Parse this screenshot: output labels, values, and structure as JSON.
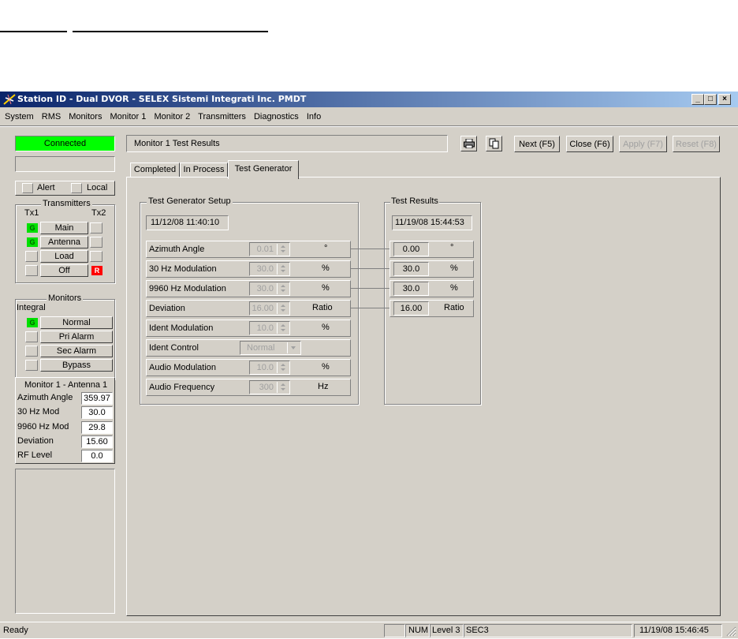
{
  "window": {
    "title": "Station ID - Dual DVOR - SELEX Sistemi Integrati Inc. PMDT"
  },
  "menu": [
    "System",
    "RMS",
    "Monitors",
    "Monitor 1",
    "Monitor 2",
    "Transmitters",
    "Diagnostics",
    "Info"
  ],
  "left_panel": {
    "connection_status": "Connected",
    "alert_label": "Alert",
    "local_label": "Local",
    "transmitters": {
      "title": "Transmitters",
      "tx1": "Tx1",
      "tx2": "Tx2",
      "rows": [
        {
          "label": "Main",
          "left": "G",
          "right": ""
        },
        {
          "label": "Antenna",
          "left": "G",
          "right": ""
        },
        {
          "label": "Load",
          "left": "",
          "right": ""
        },
        {
          "label": "Off",
          "left": "",
          "right": "R"
        }
      ]
    },
    "monitors": {
      "title": "Monitors",
      "subtitle": "Integral",
      "rows": [
        {
          "label": "Normal",
          "led": "G"
        },
        {
          "label": "Pri Alarm",
          "led": ""
        },
        {
          "label": "Sec Alarm",
          "led": ""
        },
        {
          "label": "Bypass",
          "led": ""
        }
      ],
      "readout_title": "Monitor 1 - Antenna 1",
      "readouts": [
        {
          "label": "Azimuth Angle",
          "value": "359.97"
        },
        {
          "label": "30 Hz Mod",
          "value": "30.0"
        },
        {
          "label": "9960 Hz Mod",
          "value": "29.8"
        },
        {
          "label": "Deviation",
          "value": "15.60"
        },
        {
          "label": "RF Level",
          "value": "0.0"
        }
      ]
    }
  },
  "header": {
    "title": "Monitor 1 Test Results",
    "print_icon": "printer-icon",
    "copy_icon": "copy-icon",
    "buttons": {
      "next": "Next (F5)",
      "close": "Close (F6)",
      "apply": "Apply (F7)",
      "reset": "Reset (F8)"
    }
  },
  "tabs": [
    "Completed",
    "In Process",
    "Test Generator"
  ],
  "test_generator_setup": {
    "title": "Test Generator Setup",
    "timestamp": "11/12/08 11:40:10",
    "rows": [
      {
        "label": "Azimuth Angle",
        "value": "0.01",
        "unit": "°"
      },
      {
        "label": "30 Hz Modulation",
        "value": "30.0",
        "unit": "%"
      },
      {
        "label": "9960 Hz Modulation",
        "value": "30.0",
        "unit": "%"
      },
      {
        "label": "Deviation",
        "value": "16.00",
        "unit": "Ratio"
      },
      {
        "label": "Ident Modulation",
        "value": "10.0",
        "unit": "%"
      },
      {
        "label": "Ident Control",
        "value": "Normal",
        "unit": ""
      },
      {
        "label": "Audio Modulation",
        "value": "10.0",
        "unit": "%"
      },
      {
        "label": "Audio Frequency",
        "value": "300",
        "unit": "Hz"
      }
    ]
  },
  "test_results": {
    "title": "Test Results",
    "timestamp": "11/19/08 15:44:53",
    "rows": [
      {
        "value": "0.00",
        "unit": "°"
      },
      {
        "value": "30.0",
        "unit": "%"
      },
      {
        "value": "30.0",
        "unit": "%"
      },
      {
        "value": "16.00",
        "unit": "Ratio"
      }
    ]
  },
  "status_bar": {
    "status": "Ready",
    "num": "NUM",
    "level": "Level 3",
    "sec": "SEC3",
    "datetime": "11/19/08 15:46:45"
  },
  "colors": {
    "titlebar": "#0a246a",
    "connected": "#00ff00",
    "led_green": "#00e000",
    "led_red": "#ff0000",
    "face": "#d4d0c8"
  }
}
